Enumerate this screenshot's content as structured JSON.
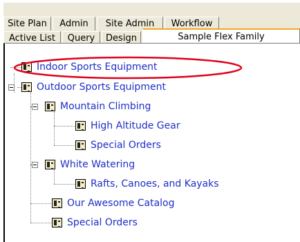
{
  "tabs": {
    "row1": [
      "Site Plan",
      "Admin",
      "Site Admin",
      "Workflow"
    ],
    "row2": [
      "Active List",
      "Query",
      "Design"
    ],
    "active": "Sample Flex Family"
  },
  "tree": {
    "nodes": [
      {
        "label": "Indoor Sports Equipment",
        "level": 0,
        "highlighted": true
      },
      {
        "label": "Outdoor Sports Equipment",
        "level": 0,
        "expanded": true
      },
      {
        "label": "Mountain Climbing",
        "level": 1,
        "expanded": true
      },
      {
        "label": "High Altitude Gear",
        "level": 2
      },
      {
        "label": "Special Orders",
        "level": 2
      },
      {
        "label": "White Watering",
        "level": 1,
        "expanded": true
      },
      {
        "label": "Rafts, Canoes, and Kayaks",
        "level": 2
      },
      {
        "label": "Our Awesome Catalog",
        "level": 1
      },
      {
        "label": "Special Orders",
        "level": 1
      }
    ],
    "icon": "asset-icon",
    "label_color": "#1d2fc5",
    "highlight_color": "#e0001a"
  }
}
